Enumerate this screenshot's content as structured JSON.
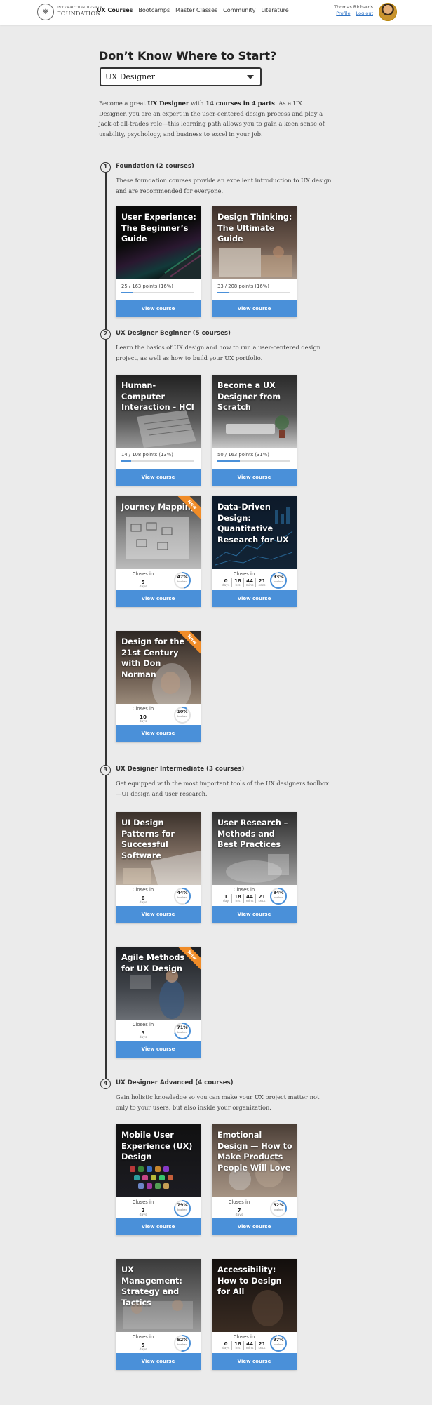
{
  "header": {
    "logo_line1": "INTERACTION DESIGN",
    "logo_line2": "FOUNDATION",
    "nav": [
      "UX Courses",
      "Bootcamps",
      "Master Classes",
      "Community",
      "Literature"
    ],
    "user_name": "Thomas Richards",
    "profile_link": "Profile",
    "separator": "|",
    "logout_link": "Log out"
  },
  "page": {
    "title": "Don’t Know Where to Start?",
    "select_value": "UX Designer",
    "intro_1": "Become a great ",
    "intro_role": "UX Designer",
    "intro_2": " with ",
    "intro_count": "14 courses in 4 parts",
    "intro_3": ". As a UX Designer, you are an expert in the user-centered design process and play a jack-of-all-trades role—this learning path allows you to gain a keen sense of usability, psychology, and business to excel in your job."
  },
  "labels": {
    "view_course": "View course",
    "closes_in": "Closes in",
    "days": "days",
    "day": "day",
    "hrs": "hrs",
    "mins": "mins",
    "secs": "secs",
    "booked": "booked",
    "new": "New"
  },
  "sections": [
    {
      "number": "1",
      "title": "Foundation (2 courses)",
      "desc": "These foundation courses provide an excellent introduction to UX design and are recommended for everyone.",
      "courses": [
        {
          "title": "User Experience: The Beginner’s Guide",
          "progress_text": "25 / 163 points (16%)",
          "progress": 0.16
        },
        {
          "title": "Design Thinking: The Ultimate Guide",
          "progress_text": "33 / 208 points (16%)",
          "progress": 0.16
        }
      ]
    },
    {
      "number": "2",
      "title": "UX Designer Beginner (5 courses)",
      "desc": "Learn the basics of UX design and how to run a user-centered design project, as well as how to build your UX portfolio.",
      "courses": [
        {
          "title": "Human-Computer Interaction - HCI",
          "progress_text": "14 / 108 points (13%)",
          "progress": 0.13
        },
        {
          "title": "Become a UX Designer from Scratch",
          "progress_text": "50 / 163 points (31%)",
          "progress": 0.31
        },
        {
          "title": "Journey Mapping",
          "closes_days": "5",
          "booked": "47%"
        },
        {
          "title": "Data-Driven Design: Quantitative Research for UX",
          "cd": [
            "0",
            "18",
            "44",
            "21"
          ],
          "booked": "93%"
        },
        {
          "title": "Design for the 21st Century with Don Norman",
          "closes_days": "10",
          "booked": "10%"
        }
      ]
    },
    {
      "number": "3",
      "title": "UX Designer Intermediate (3 courses)",
      "desc": "Get equipped with the most important tools of the UX designers toolbox—UI design and user research.",
      "courses": [
        {
          "title": "UI Design Patterns for Successful Software",
          "closes_days": "6",
          "booked": "44%"
        },
        {
          "title": "User Research – Methods and Best Practices",
          "cd": [
            "1",
            "18",
            "44",
            "21"
          ],
          "booked": "84%"
        },
        {
          "title": "Agile Methods for UX Design",
          "closes_days": "3",
          "booked": "71%"
        }
      ]
    },
    {
      "number": "4",
      "title": "UX Designer Advanced (4 courses)",
      "desc": "Gain holistic knowledge so you can make your UX project matter not only to your users, but also inside your organization.",
      "courses": [
        {
          "title": "Mobile User Experience (UX) Design",
          "closes_days": "2",
          "booked": "79%"
        },
        {
          "title": "Emotional Design — How to Make Products People Will Love",
          "closes_days": "7",
          "booked": "32%"
        },
        {
          "title": "UX Management: Strategy and Tactics",
          "closes_days": "5",
          "booked": "52%"
        },
        {
          "title": "Accessibility: How to Design for All",
          "cd": [
            "0",
            "18",
            "44",
            "21"
          ],
          "booked": "97%"
        }
      ]
    }
  ],
  "colors": {
    "accent": "#4a90d9",
    "ribbon": "#f08c28"
  }
}
